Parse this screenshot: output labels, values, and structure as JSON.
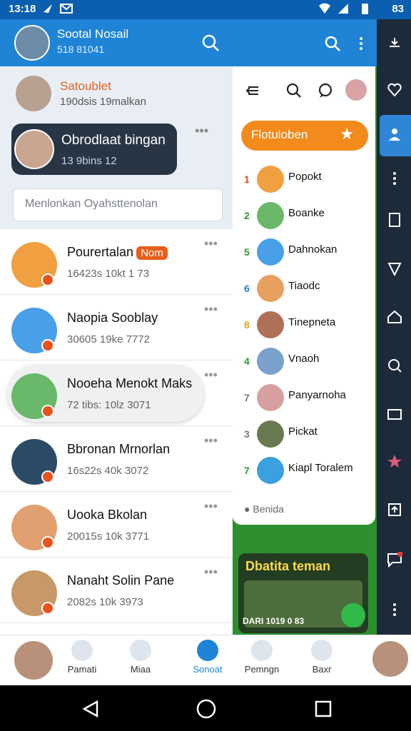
{
  "status": {
    "time": "13:18",
    "battery": "83"
  },
  "left": {
    "app_title": "Sootal Nosail",
    "app_subtitle": "518 81041",
    "pinned": {
      "name": "Satoublet",
      "sub": "190dsis 19malkan"
    },
    "pill": {
      "name": "Obrodlaat bingan",
      "sub": "13 9bins 12"
    },
    "search_placeholder": "Menlonkan Oyahsttenolan",
    "chats": [
      {
        "name": "Pourertalan",
        "tag": "Nom",
        "sub": "16423s 10kt 1 73",
        "color": "#f0a040"
      },
      {
        "name": "Naopia Sooblay",
        "tag": "",
        "sub": "30605 19ke 7772",
        "color": "#4aa0e8"
      },
      {
        "name": "Nooeha Menokt Maks",
        "tag": "",
        "sub": "72 tibs: 10lz 3071",
        "color": "#6ab86a"
      },
      {
        "name": "Bbronan Mrnorlan",
        "tag": "",
        "sub": "16s22s 40k 3072",
        "color": "#2a4a66"
      },
      {
        "name": "Uooka Bkolan",
        "tag": "",
        "sub": "20015s 10k 3771",
        "color": "#e2a070"
      },
      {
        "name": "Nanaht Solin Pane",
        "tag": "",
        "sub": "2082s 10k 3973",
        "color": "#c89868"
      }
    ]
  },
  "mid": {
    "favorites_label": "Flotuloben",
    "list": [
      {
        "num": "1",
        "name": "Popokt",
        "numColor": "#e74c1a",
        "avColor": "#f0a040"
      },
      {
        "num": "2",
        "name": "Boanke",
        "numColor": "#2e9b2e",
        "avColor": "#6ab86a"
      },
      {
        "num": "5",
        "name": "Dahnokan",
        "numColor": "#2e9b2e",
        "avColor": "#4aa0e8"
      },
      {
        "num": "6",
        "name": "Tiaodc",
        "numColor": "#1f84d6",
        "avColor": "#e8a060"
      },
      {
        "num": "8",
        "name": "Tinepneta",
        "numColor": "#e6a21b",
        "avColor": "#b07058"
      },
      {
        "num": "4",
        "name": "Vnaoh",
        "numColor": "#2e9b2e",
        "avColor": "#7aa0cc"
      },
      {
        "num": "7",
        "name": "Panyarnoha",
        "numColor": "#777",
        "avColor": "#d6a0a0"
      },
      {
        "num": "3",
        "name": "Pickat",
        "numColor": "#777",
        "avColor": "#6a7a50"
      },
      {
        "num": "7",
        "name": "Kiapl Toralem",
        "numColor": "#2e9b2e",
        "avColor": "#3aa0e0"
      }
    ],
    "more_label": "Benida",
    "promo_title": "Dbatita teman",
    "promo_bottom": "DARI 1019 0 83"
  },
  "bottom_nav": [
    {
      "label": "Pamati"
    },
    {
      "label": "Miaa"
    },
    {
      "label": "Sonoat"
    },
    {
      "label": "Pemngn"
    },
    {
      "label": "Baxr"
    }
  ]
}
